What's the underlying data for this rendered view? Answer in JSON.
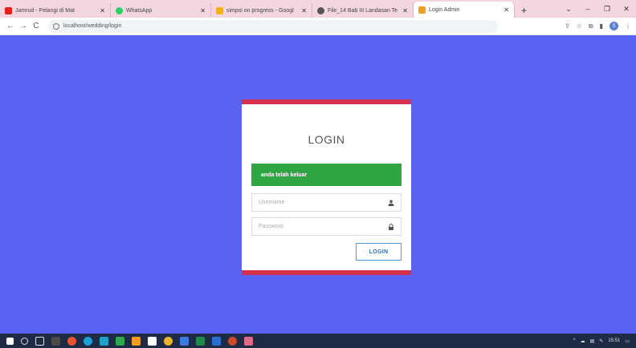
{
  "browser": {
    "tabs": [
      {
        "title": "Jamrud - Pelangi di Mat",
        "favicon_color": "#e62117",
        "active": false
      },
      {
        "title": "WhatsApp",
        "favicon_color": "#25d366",
        "active": false
      },
      {
        "title": "simpsi on progress - Googl",
        "favicon_color": "#f4b400",
        "active": false
      },
      {
        "title": "File_14 Bab III Landasan Te",
        "favicon_color": "#555555",
        "active": false
      },
      {
        "title": "Login Admin",
        "favicon_color": "#f0a020",
        "active": true
      }
    ],
    "new_tab_label": "+",
    "address": "localhost/wedding/login",
    "window_controls": {
      "minimize": "–",
      "maximize": "❐",
      "close": "✕"
    },
    "nav": {
      "back": "←",
      "forward": "→",
      "reload": "C"
    },
    "profile_initial": "S"
  },
  "page": {
    "background_color": "#5b61f0",
    "card_border_color": "#d5304e",
    "title": "LOGIN",
    "alert": {
      "text": "anda telah keluar",
      "color": "#2fa543"
    },
    "username": {
      "value": "",
      "placeholder": "Username"
    },
    "password": {
      "value": "",
      "placeholder": "Password"
    },
    "submit_label": "LOGIN",
    "icons": {
      "username": "user-icon",
      "password": "lock-icon"
    }
  },
  "taskbar": {
    "icons": [
      "windows-start-icon",
      "search-icon",
      "task-view-icon",
      "app-icon",
      "app-icon",
      "edge-icon",
      "app-icon",
      "app-icon",
      "app-icon",
      "chrome-icon",
      "app-icon",
      "app-icon",
      "app-icon",
      "app-icon",
      "app-icon"
    ],
    "time": "15:51"
  }
}
